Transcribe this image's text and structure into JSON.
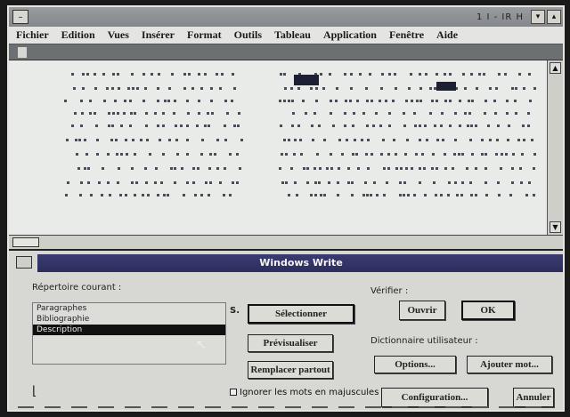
{
  "window": {
    "title": "1  I  -  IR  H",
    "menu": [
      "Fichier",
      "Edition",
      "Vues",
      "Insérer",
      "Format",
      "Outils",
      "Tableau",
      "Fenêtre",
      "Application",
      "Fenêtre",
      "Aide"
    ]
  },
  "dialog": {
    "title": "Windows Write",
    "list_label": "Répertoire courant :",
    "list_items": [
      "Paragraphes",
      "Bibliographie",
      "Description"
    ],
    "selected_item": "Description",
    "field_prefix": "S.",
    "buttons": {
      "selectall": "Sélectionner",
      "preview": "Prévisualiser",
      "replace": "Remplacer partout",
      "open": "Ouvrir",
      "ok": "OK",
      "options": "Options...",
      "addword": "Ajouter mot...",
      "autocorrect": "Configuration...",
      "cancel": "Annuler"
    },
    "right_label": "Vérifier :",
    "right_sublabel": "Dictionnaire utilisateur :",
    "checkbox_label": "Ignorer les mots en majuscules"
  }
}
